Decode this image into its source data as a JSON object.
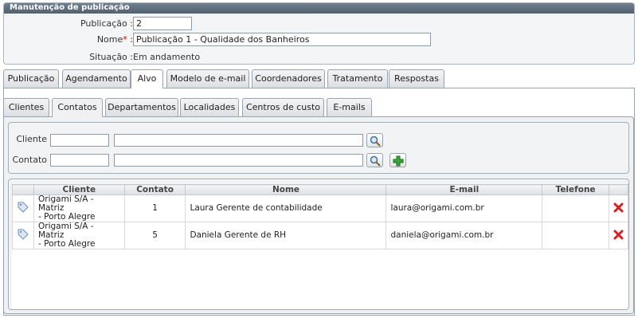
{
  "header": {
    "title": "Manutenção de publicação"
  },
  "form": {
    "publicacao": {
      "label": "Publicação :",
      "value": "2"
    },
    "nome": {
      "label": "Nome",
      "required": "*",
      "colon": ":",
      "value": "Publicação 1 - Qualidade dos Banheiros"
    },
    "situacao": {
      "label": "Situação :",
      "value": "Em andamento"
    }
  },
  "tabs": [
    "Publicação",
    "Agendamento",
    "Alvo",
    "Modelo de e-mail",
    "Coordenadores",
    "Tratamento",
    "Respostas"
  ],
  "active_tab": "Alvo",
  "subtabs": [
    "Clientes",
    "Contatos",
    "Departamentos",
    "Localidades",
    "Centros de custo",
    "E-mails"
  ],
  "active_subtab": "Contatos",
  "filters": {
    "cliente_label": "Cliente",
    "contato_label": "Contato"
  },
  "grid": {
    "columns": [
      "Cliente",
      "Contato",
      "Nome",
      "E-mail",
      "Telefone"
    ],
    "rows": [
      {
        "cliente_line1": "Origami S/A - Matriz",
        "cliente_line2": "- Porto Alegre",
        "contato": "1",
        "nome": "Laura Gerente de contabilidade",
        "email": "laura@origami.com.br",
        "telefone": ""
      },
      {
        "cliente_line1": "Origami S/A - Matriz",
        "cliente_line2": "- Porto Alegre",
        "contato": "5",
        "nome": "Daniela Gerente de RH",
        "email": "daniela@origami.com.br",
        "telefone": ""
      }
    ]
  },
  "icons": {
    "search": "search-icon",
    "add": "add-icon",
    "delete": "delete-icon",
    "tag": "tag-icon"
  },
  "colors": {
    "title_bar": "#5f6e7d",
    "required": "#dd0000",
    "delete": "#d42020",
    "add": "#2e9a2e"
  }
}
